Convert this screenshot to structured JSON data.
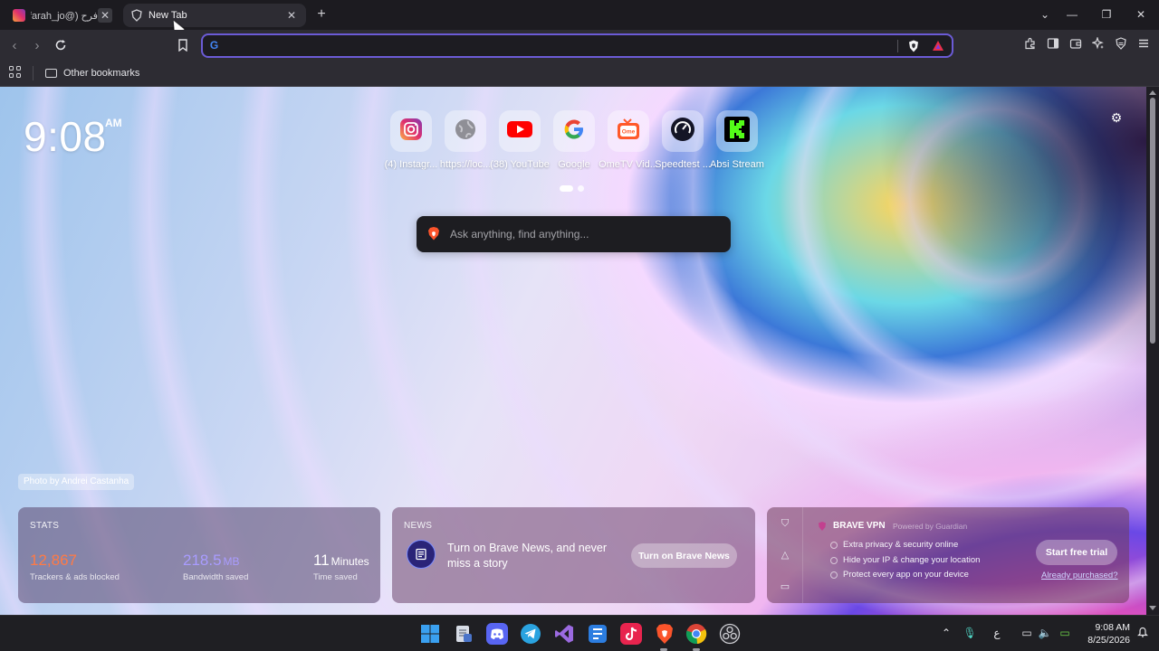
{
  "browser": {
    "tabs": [
      {
        "title": "فرح (@farah_jo_",
        "favicon": "instagram-icon"
      },
      {
        "title": "New Tab",
        "favicon": "brave-shield-icon",
        "active": true
      }
    ],
    "address_bar": {
      "value": "",
      "search_engine_icon": "google-icon"
    },
    "bookmarks": {
      "other_label": "Other bookmarks"
    }
  },
  "ntp": {
    "clock": {
      "time": "9:08",
      "ampm": "AM"
    },
    "top_sites": [
      {
        "label": "(4) Instagr...",
        "icon": "instagram-icon"
      },
      {
        "label": "https://loc...",
        "icon": "globe-icon"
      },
      {
        "label": "(38) YouTube",
        "icon": "youtube-icon"
      },
      {
        "label": "Google",
        "icon": "google-icon"
      },
      {
        "label": "OmeTV Vid...",
        "icon": "ometv-icon"
      },
      {
        "label": "Speedtest ...",
        "icon": "speedtest-icon"
      },
      {
        "label": "Absi Stream",
        "icon": "kick-icon"
      }
    ],
    "search": {
      "placeholder": "Ask anything, find anything..."
    },
    "photo_credit": "Photo by Andrei Castanha",
    "stats": {
      "title": "STATS",
      "trackers_value": "12,867",
      "trackers_label": "Trackers & ads blocked",
      "bandwidth_value": "218.5",
      "bandwidth_unit": "MB",
      "bandwidth_label": "Bandwidth saved",
      "time_value": "11",
      "time_unit": "Minutes",
      "time_label": "Time saved"
    },
    "news": {
      "title": "NEWS",
      "text": "Turn on Brave News, and never miss a story",
      "button": "Turn on Brave News"
    },
    "vpn": {
      "title": "BRAVE VPN",
      "powered_by": "Powered by  Guardian",
      "features": [
        "Extra privacy & security online",
        "Hide your IP & change your location",
        "Protect every app on your device"
      ],
      "button": "Start free trial",
      "link": "Already purchased?"
    }
  },
  "taskbar": {
    "time": "9:08 AM",
    "date": "8/25/2026",
    "language": "ع"
  },
  "colors": {
    "accent_border": "#6b5bd6",
    "tracker_orange": "#ff7a45",
    "bandwidth_purple": "#a99cff"
  }
}
